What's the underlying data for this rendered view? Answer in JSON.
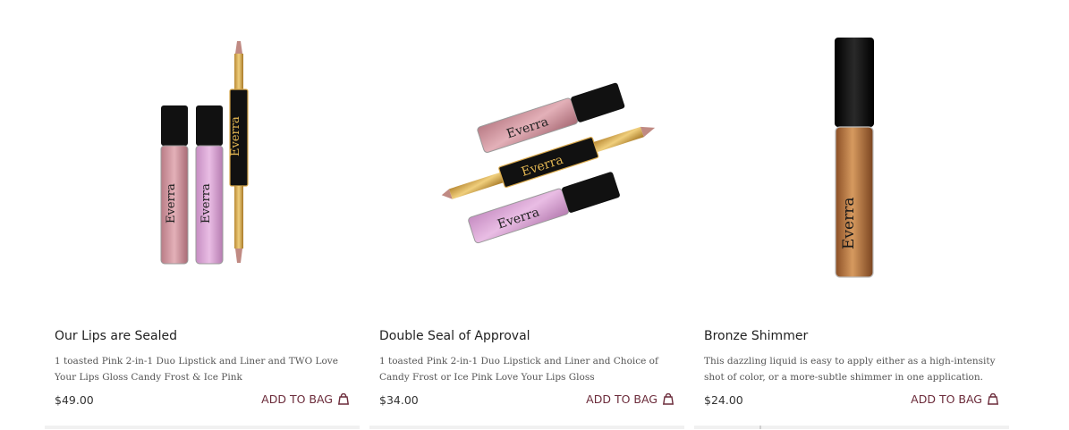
{
  "products": [
    {
      "title": "Our Lips are Sealed",
      "description": "1 toasted Pink 2-in-1 Duo Lipstick and Liner and TWO Love Your Lips Gloss Candy Frost & Ice Pink",
      "price": "$49.00",
      "cta": "ADD TO BAG",
      "brand": "Everra"
    },
    {
      "title": "Double Seal of Approval",
      "description": "1 toasted Pink 2-in-1 Duo Lipstick and Liner and Choice of Candy Frost or Ice Pink Love Your Lips Gloss",
      "price": "$34.00",
      "cta": "ADD TO BAG",
      "brand": "Everra"
    },
    {
      "title": "Bronze Shimmer",
      "description": "This dazzling liquid is easy to apply either as a high-intensity shot of color, or a more-subtle shimmer in one application.",
      "price": "$24.00",
      "cta": "ADD TO BAG",
      "brand": "Everra"
    }
  ],
  "colors": {
    "accent": "#6b2b3a",
    "pink_gloss": "#d79aa4",
    "lilac_gloss": "#dba6d7",
    "bronze_gloss": "#b06e3a",
    "gold": "#d9a94b"
  },
  "icons": {
    "add_to_bag": "shopping-bag-icon"
  }
}
